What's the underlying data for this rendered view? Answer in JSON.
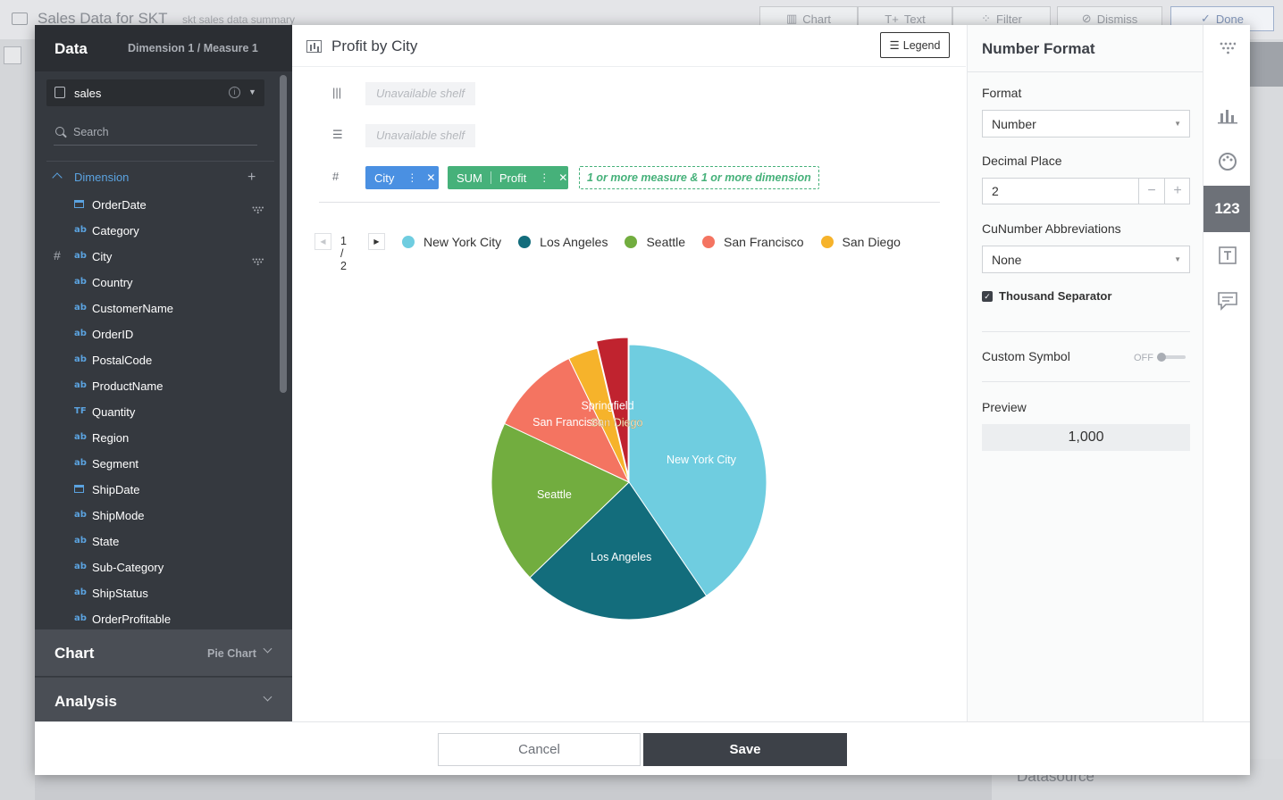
{
  "background": {
    "app_title": "Sales Data for SKT",
    "app_subtitle": "skt sales data summary",
    "toolbar": {
      "chart": "Chart",
      "text": "Text",
      "filter": "Filter",
      "dismiss": "Dismiss",
      "done": "Done"
    },
    "datasource": "Datasource"
  },
  "data_panel": {
    "title": "Data",
    "subtitle": "Dimension 1 / Measure 1",
    "datasource_name": "sales",
    "search_placeholder": "Search",
    "dimension_label": "Dimension",
    "fields": [
      {
        "name": "OrderDate",
        "type": "date",
        "icon": "calendar-icon",
        "shelf": false,
        "filter": true
      },
      {
        "name": "Category",
        "type": "ab",
        "icon": "ab",
        "shelf": false,
        "filter": false
      },
      {
        "name": "City",
        "type": "ab",
        "icon": "ab",
        "shelf": true,
        "filter": true
      },
      {
        "name": "Country",
        "type": "ab",
        "icon": "ab",
        "shelf": false,
        "filter": false
      },
      {
        "name": "CustomerName",
        "type": "ab",
        "icon": "ab",
        "shelf": false,
        "filter": false
      },
      {
        "name": "OrderID",
        "type": "ab",
        "icon": "ab",
        "shelf": false,
        "filter": false
      },
      {
        "name": "PostalCode",
        "type": "ab",
        "icon": "ab",
        "shelf": false,
        "filter": false
      },
      {
        "name": "ProductName",
        "type": "ab",
        "icon": "ab",
        "shelf": false,
        "filter": false
      },
      {
        "name": "Quantity",
        "type": "tf",
        "icon": "TF",
        "shelf": false,
        "filter": false
      },
      {
        "name": "Region",
        "type": "ab",
        "icon": "ab",
        "shelf": false,
        "filter": false
      },
      {
        "name": "Segment",
        "type": "ab",
        "icon": "ab",
        "shelf": false,
        "filter": false
      },
      {
        "name": "ShipDate",
        "type": "date",
        "icon": "calendar-icon",
        "shelf": false,
        "filter": false
      },
      {
        "name": "ShipMode",
        "type": "ab",
        "icon": "ab",
        "shelf": false,
        "filter": false
      },
      {
        "name": "State",
        "type": "ab",
        "icon": "ab",
        "shelf": false,
        "filter": false
      },
      {
        "name": "Sub-Category",
        "type": "ab",
        "icon": "ab",
        "shelf": false,
        "filter": false
      },
      {
        "name": "ShipStatus",
        "type": "ab",
        "icon": "ab",
        "shelf": false,
        "filter": false
      },
      {
        "name": "OrderProfitable",
        "type": "ab",
        "icon": "ab",
        "shelf": false,
        "filter": false
      }
    ],
    "chart_section": {
      "label": "Chart",
      "value": "Pie Chart"
    },
    "analysis_section": {
      "label": "Analysis"
    }
  },
  "main": {
    "title": "Profit by City",
    "legend_button": "Legend",
    "shelves": {
      "column_placeholder": "Unavailable shelf",
      "row_placeholder": "Unavailable shelf",
      "dimension_pill": "City",
      "measure_agg": "SUM",
      "measure_pill": "Profit",
      "drop_hint": "1 or more measure & 1 or more dimension"
    },
    "pager": "1 / 2"
  },
  "chart_data": {
    "type": "pie",
    "categories": [
      "New York City",
      "Los Angeles",
      "Seattle",
      "San Francisco",
      "San Diego",
      "Springfield"
    ],
    "values": [
      40.5,
      22.3,
      19.2,
      10.8,
      3.5,
      3.7
    ],
    "colors": [
      "#6fcde0",
      "#136d7c",
      "#72ad3f",
      "#f47461",
      "#f6b32b",
      "#c0232f"
    ],
    "legend": [
      "New York City",
      "Los Angeles",
      "Seattle",
      "San Francisco",
      "San Diego"
    ],
    "legend_placement": "top",
    "highlighted": "Springfield"
  },
  "format_panel": {
    "title": "Number Format",
    "format_label": "Format",
    "format_value": "Number",
    "decimal_label": "Decimal Place",
    "decimal_value": "2",
    "abbr_label": "CuNumber Abbreviations",
    "abbr_value": "None",
    "thousand_label": "Thousand Separator",
    "custom_symbol_label": "Custom Symbol",
    "toggle_state": "OFF",
    "preview_label": "Preview",
    "preview_value": "1,000"
  },
  "rail": {
    "items": [
      "filter-icon",
      "bar-chart-icon",
      "palette-icon",
      "number-format-icon",
      "text-icon",
      "comment-icon"
    ],
    "active_label": "123"
  },
  "footer": {
    "cancel": "Cancel",
    "save": "Save"
  }
}
